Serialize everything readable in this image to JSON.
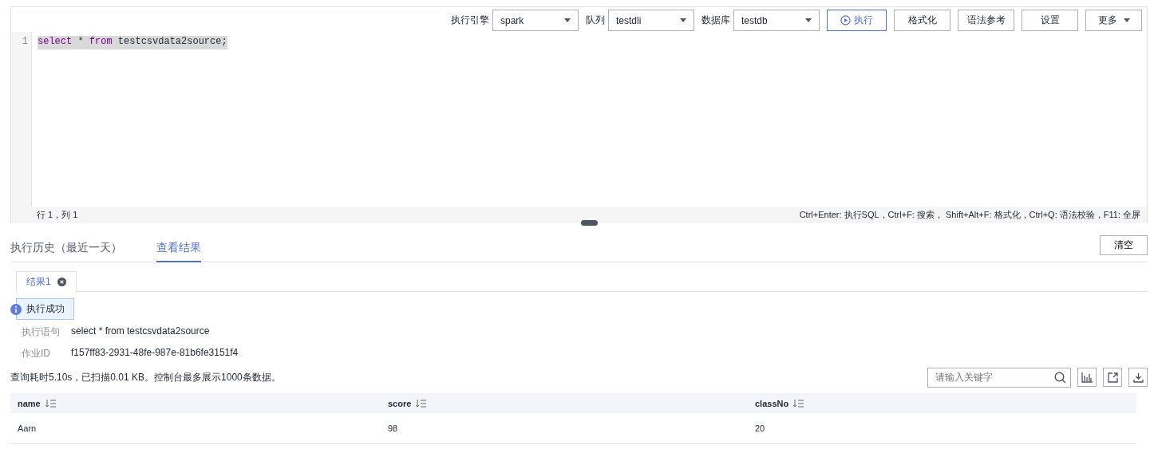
{
  "toolbar": {
    "selects": [
      {
        "label": "执行引擎",
        "value": "spark"
      },
      {
        "label": "队列",
        "value": "testdli"
      },
      {
        "label": "数据库",
        "value": "testdb"
      }
    ],
    "buttons": [
      {
        "label": "执行",
        "kind": "primary"
      },
      {
        "label": "格式化",
        "kind": "plain"
      },
      {
        "label": "语法参考",
        "kind": "plain"
      },
      {
        "label": "设置",
        "kind": "plain"
      },
      {
        "label": "更多",
        "kind": "dropdown"
      }
    ]
  },
  "editor": {
    "lines": [
      {
        "number": "1",
        "selected": true,
        "tokens": [
          {
            "text": "select",
            "kind": "keyword"
          },
          {
            "text": " * ",
            "kind": "plain"
          },
          {
            "text": "from",
            "kind": "keyword"
          },
          {
            "text": " testcsvdata2source;",
            "kind": "plain"
          }
        ]
      }
    ],
    "cursor": "行 1，列 1",
    "shortcuts": "Ctrl+Enter: 执行SQL，Ctrl+F: 搜索， Shift+Alt+F: 格式化，Ctrl+Q: 语法校验，F11: 全屏"
  },
  "tabs": [
    {
      "label": "执行历史（最近一天）",
      "selected": false
    },
    {
      "label": "查看结果",
      "selected": true
    }
  ],
  "clear_button": "清空",
  "result_tabs": [
    {
      "label": "结果1",
      "selected": true
    }
  ],
  "status_badge": "执行成功",
  "details": [
    {
      "label": "执行语句",
      "value": "select * from testcsvdata2source"
    },
    {
      "label": "作业ID",
      "value": "f157ff83-2931-48fe-987e-81b6fe3151f4"
    }
  ],
  "summary": "查询耗时5.10s，已扫描0.01 KB。控制台最多展示1000条数据。",
  "search": {
    "placeholder": "请输入关键字"
  },
  "table": {
    "columns": [
      "name",
      "score",
      "classNo"
    ],
    "rows": [
      [
        "Aarn",
        "98",
        "20"
      ]
    ]
  }
}
